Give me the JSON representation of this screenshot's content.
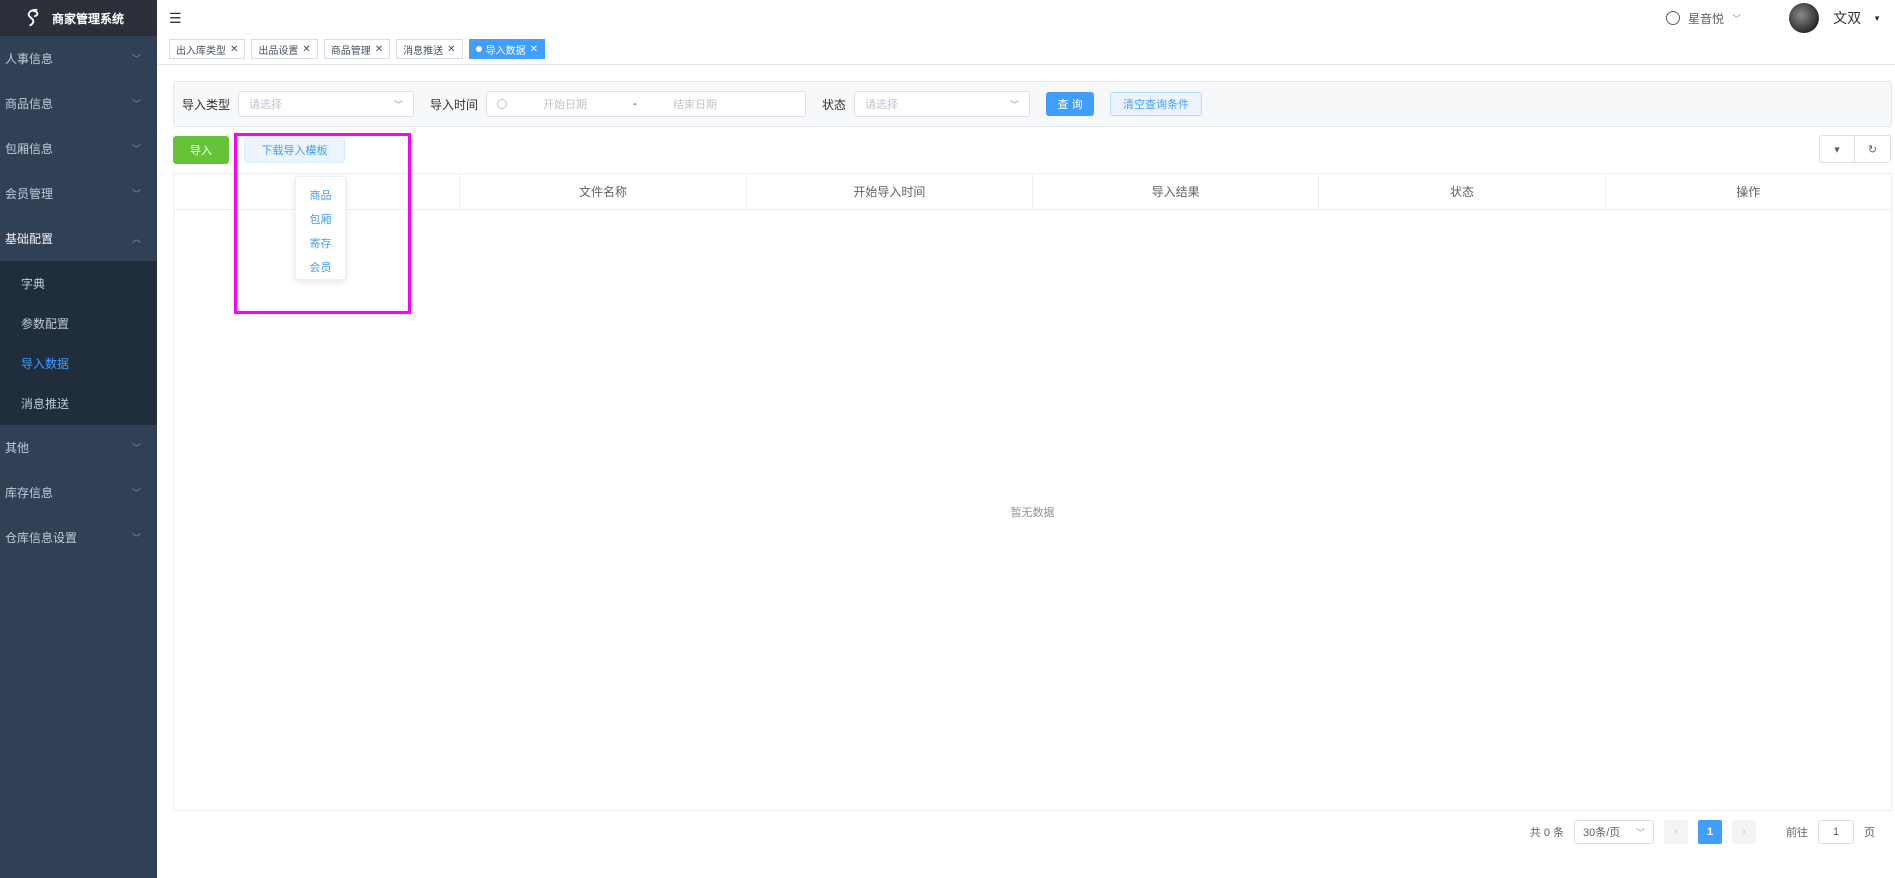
{
  "app": {
    "title": "商家管理系统"
  },
  "sidebar": {
    "items": [
      {
        "label": "人事信息"
      },
      {
        "label": "商品信息"
      },
      {
        "label": "包厢信息"
      },
      {
        "label": "会员管理"
      },
      {
        "label": "基础配置"
      },
      {
        "label": "其他"
      },
      {
        "label": "库存信息"
      },
      {
        "label": "仓库信息设置"
      }
    ],
    "submenu": [
      {
        "label": "字典"
      },
      {
        "label": "参数配置"
      },
      {
        "label": "导入数据"
      },
      {
        "label": "消息推送"
      }
    ]
  },
  "navbar": {
    "shop": "星音悦",
    "user": "文双"
  },
  "tags": [
    {
      "label": "出入库类型"
    },
    {
      "label": "出品设置"
    },
    {
      "label": "商品管理"
    },
    {
      "label": "消息推送"
    },
    {
      "label": "导入数据"
    }
  ],
  "query": {
    "type_label": "导入类型",
    "type_placeholder": "请选择",
    "time_label": "导入时间",
    "start_placeholder": "开始日期",
    "range_sep": "-",
    "end_placeholder": "结束日期",
    "status_label": "状态",
    "status_placeholder": "请选择",
    "search": "查 询",
    "clear": "清空查询条件"
  },
  "actions": {
    "import": "导入",
    "download": "下载导入模板",
    "dropdown": [
      "商品",
      "包厢",
      "寄存",
      "会员"
    ]
  },
  "table": {
    "columns": [
      "",
      "文件名称",
      "开始导入时间",
      "导入结果",
      "状态",
      "操作"
    ],
    "empty": "暂无数据"
  },
  "pagination": {
    "total": "共 0 条",
    "page_size": "30条/页",
    "current": "1",
    "goto_label": "前往",
    "goto_value": "1",
    "page_unit": "页"
  },
  "colors": {
    "sidebar_bg": "#304156",
    "primary": "#409eff",
    "success": "#67c23a",
    "highlight": "#ff00ff"
  }
}
